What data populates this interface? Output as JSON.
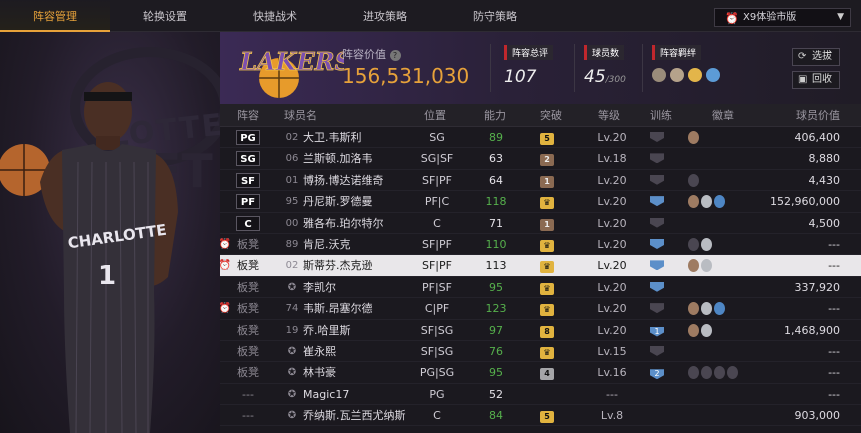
{
  "tabs": [
    "阵容管理",
    "轮换设置",
    "快捷战术",
    "进攻策略",
    "防守策略"
  ],
  "version_select": "X9体验市版",
  "team": {
    "logo_text": "LAKERS",
    "value_label": "阵容价值",
    "value": "156,531,030",
    "rating_label": "阵容总评",
    "rating": "107",
    "count_label": "球员数",
    "count": "45",
    "count_max": "/300",
    "bond_label": "阵容羁绊"
  },
  "buttons": {
    "select": "选拔",
    "recycle": "回收"
  },
  "columns": [
    "阵容",
    "球员名",
    "位置",
    "能力",
    "突破",
    "等级",
    "训练",
    "徽章",
    "球员价值"
  ],
  "art": {
    "t1": "LOTTE",
    "t2": "ET"
  },
  "rows": [
    {
      "slot": "PG",
      "starter": true,
      "star": false,
      "num": "02",
      "name": "大卫.韦斯利",
      "pos": "SG",
      "abil": "89",
      "abil_c": "g",
      "brk": "5",
      "brk_c": "gold",
      "lv": "Lv.20",
      "train": "",
      "salary": "406,400"
    },
    {
      "slot": "SG",
      "starter": true,
      "star": false,
      "num": "06",
      "name": "兰斯顿.加洛韦",
      "pos": "SG|SF",
      "abil": "63",
      "abil_c": "w",
      "brk": "2",
      "brk_c": "brown",
      "lv": "Lv.18",
      "train": "",
      "salary": "8,880"
    },
    {
      "slot": "SF",
      "starter": true,
      "star": false,
      "num": "01",
      "name": "博扬.博达诺维奇",
      "pos": "SF|PF",
      "abil": "64",
      "abil_c": "w",
      "brk": "1",
      "brk_c": "brown",
      "lv": "Lv.20",
      "train": "",
      "salary": "4,430"
    },
    {
      "slot": "PF",
      "starter": true,
      "star": false,
      "num": "95",
      "name": "丹尼斯.罗德曼",
      "pos": "PF|C",
      "abil": "118",
      "abil_c": "g",
      "brk": "♛",
      "brk_c": "gold",
      "lv": "Lv.20",
      "train": "",
      "salary": "152,960,000"
    },
    {
      "slot": "C",
      "starter": true,
      "star": false,
      "num": "00",
      "name": "雅各布.珀尔特尔",
      "pos": "C",
      "abil": "71",
      "abil_c": "w",
      "brk": "1",
      "brk_c": "brown",
      "lv": "Lv.20",
      "train": "",
      "salary": "4,500"
    },
    {
      "slot": "板凳",
      "starter": false,
      "star": true,
      "num": "89",
      "name": "肯尼.沃克",
      "pos": "SF|PF",
      "abil": "110",
      "abil_c": "g",
      "brk": "♛",
      "brk_c": "gold",
      "lv": "Lv.20",
      "train": "",
      "salary": "---"
    },
    {
      "slot": "板凳",
      "starter": false,
      "star": true,
      "num": "02",
      "name": "斯蒂芬.杰克逊",
      "pos": "SF|PF",
      "abil": "113",
      "abil_c": "w",
      "brk": "♛",
      "brk_c": "gold",
      "lv": "Lv.20",
      "train": "",
      "salary": "---"
    },
    {
      "slot": "板凳",
      "starter": false,
      "star": false,
      "num": "",
      "name": "李凯尔",
      "pos": "PF|SF",
      "abil": "95",
      "abil_c": "g",
      "brk": "♛",
      "brk_c": "gold",
      "lv": "Lv.20",
      "train": "",
      "salary": "337,920"
    },
    {
      "slot": "板凳",
      "starter": false,
      "star": true,
      "num": "74",
      "name": "韦斯.昂塞尔德",
      "pos": "C|PF",
      "abil": "123",
      "abil_c": "g",
      "brk": "♛",
      "brk_c": "gold",
      "lv": "Lv.20",
      "train": "",
      "salary": "---"
    },
    {
      "slot": "板凳",
      "starter": false,
      "star": false,
      "num": "19",
      "name": "乔.哈里斯",
      "pos": "SF|SG",
      "abil": "97",
      "abil_c": "g",
      "brk": "8",
      "brk_c": "gold",
      "lv": "Lv.20",
      "train": "1",
      "salary": "1,468,900"
    },
    {
      "slot": "板凳",
      "starter": false,
      "star": false,
      "num": "",
      "name": "崔永熙",
      "pos": "SF|SG",
      "abil": "76",
      "abil_c": "g",
      "brk": "♛",
      "brk_c": "gold",
      "lv": "Lv.15",
      "train": "",
      "salary": "---"
    },
    {
      "slot": "板凳",
      "starter": false,
      "star": false,
      "num": "",
      "name": "林书豪",
      "pos": "PG|SG",
      "abil": "95",
      "abil_c": "g",
      "brk": "4",
      "brk_c": "grey",
      "lv": "Lv.16",
      "train": "2",
      "salary": "---"
    },
    {
      "slot": "---",
      "starter": false,
      "star": false,
      "num": "",
      "name": "Magic17",
      "pos": "PG",
      "abil": "52",
      "abil_c": "w",
      "brk": "",
      "brk_c": "",
      "lv": "---",
      "train": "",
      "salary": "---"
    },
    {
      "slot": "---",
      "starter": false,
      "star": false,
      "num": "",
      "name": "乔纳斯.瓦兰西尤纳斯",
      "pos": "C",
      "abil": "84",
      "abil_c": "g",
      "brk": "5",
      "brk_c": "gold",
      "lv": "Lv.8",
      "train": "",
      "salary": "903,000"
    }
  ],
  "accent": "#e7a23a",
  "green_value": "#56b04c"
}
